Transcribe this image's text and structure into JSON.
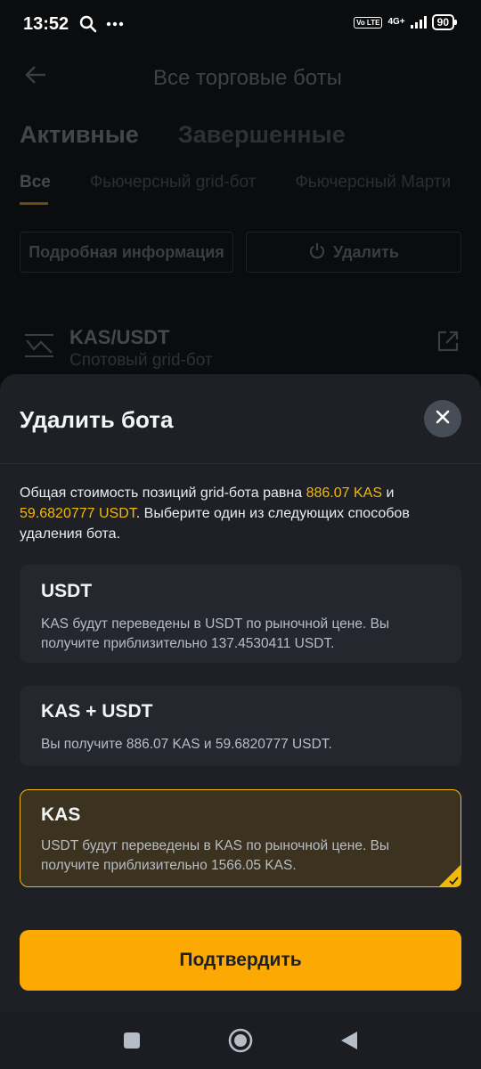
{
  "status_bar": {
    "time": "13:52",
    "volte": "Vo LTE",
    "network": "4G+",
    "battery": "90"
  },
  "background": {
    "title": "Все торговые боты",
    "tabs": [
      "Активные",
      "Завершенные"
    ],
    "filters": [
      "Все",
      "Фьючерсный grid-бот",
      "Фьючерсный Марти"
    ],
    "details_button": "Подробная информация",
    "delete_button": "Удалить",
    "bot": {
      "name": "KAS/USDT",
      "type": "Спотовый grid-бот"
    }
  },
  "sheet": {
    "title": "Удалить бота",
    "description": {
      "part1": "Общая стоимость позиций grid-бота равна ",
      "value_kas": "886.07 KAS",
      "part2": " и ",
      "value_usdt": "59.6820777 USDT",
      "part3": ". Выберите один из следующих способов удаления бота."
    },
    "options": [
      {
        "title": "USDT",
        "description": "KAS будут переведены в USDT по рыночной цене. Вы получите приблизительно 137.4530411 USDT.",
        "selected": false
      },
      {
        "title": "KAS + USDT",
        "description": "Вы получите 886.07 KAS и 59.6820777 USDT.",
        "selected": false
      },
      {
        "title": "KAS",
        "description": "USDT будут переведены в KAS по рыночной цене. Вы получите приблизительно 1566.05 KAS.",
        "selected": true
      }
    ],
    "confirm_button": "Подтвердить"
  },
  "colors": {
    "accent": "#f0b90b",
    "button": "#fcaa03",
    "sheet_bg": "#1e2026",
    "option_bg": "#24272e",
    "selected_bg": "#3c3220"
  },
  "icons": {
    "search": "search-icon",
    "more": "more-dots-icon",
    "back": "back-arrow-icon",
    "power": "power-icon",
    "external": "external-link-icon",
    "close": "close-icon",
    "check": "checkmark-icon"
  }
}
